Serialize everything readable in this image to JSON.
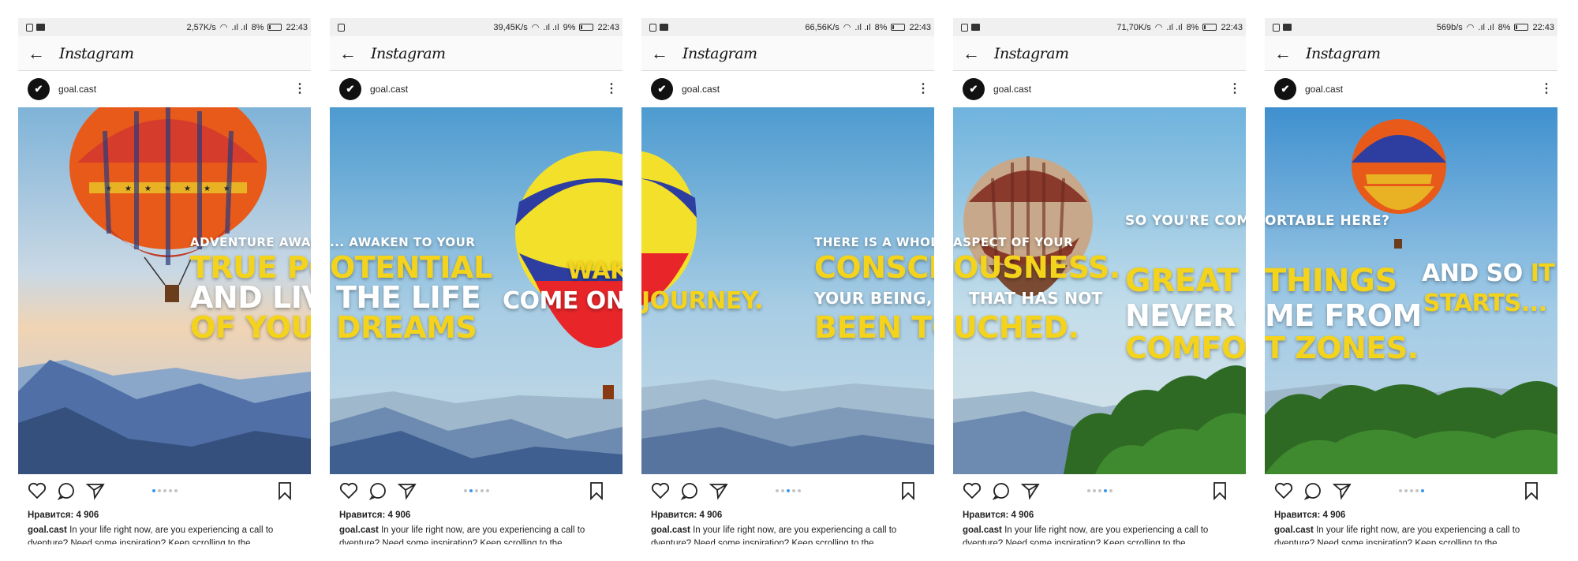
{
  "app": {
    "title": "Instagram",
    "username": "goal.cast",
    "likes": "Нравится: 4 906",
    "caption_text": "In your life right now, are you experiencing a call to",
    "caption_line2": "dventure? Need some inspiration? Keep scrolling to the",
    "back_icon": "arrow-left-icon",
    "accent": "#3897f0",
    "yellow_text_color": "#f4d31c"
  },
  "screens": [
    {
      "status": {
        "speed": "2,57K/s",
        "battery": "8%",
        "time": "22:43"
      },
      "active_dot": 0,
      "overlay": [
        "ADVENTURE AWAITS...",
        "TRUE PO",
        "AND LIVE",
        "OF YOUR"
      ]
    },
    {
      "status": {
        "speed": "39,45K/s",
        "battery": "9%",
        "time": "22:43"
      },
      "active_dot": 1,
      "overlay": [
        "... AWAKEN TO YOUR",
        "OTENTIAL",
        "THE LIFE",
        "DREAMS",
        "WAKE UP.",
        "COME ON A"
      ]
    },
    {
      "status": {
        "speed": "66,56K/s",
        "battery": "8%",
        "time": "22:43"
      },
      "active_dot": 2,
      "overlay": [
        "JOURNEY.",
        "THERE IS A WHOLE",
        "CONSCIO",
        "YOUR BEING, T",
        "BEEN TO"
      ]
    },
    {
      "status": {
        "speed": "71,70K/s",
        "battery": "8%",
        "time": "22:43"
      },
      "active_dot": 3,
      "overlay": [
        "ASPECT OF YOUR",
        "OUSNESS.",
        "THAT HAS NOT",
        "UCHED.",
        "SO YOU'RE COMF",
        "GREAT T",
        "NEVER CA",
        "COMFOR"
      ]
    },
    {
      "status": {
        "speed": "569b/s",
        "battery": "8%",
        "time": "22:43"
      },
      "active_dot": 4,
      "overlay": [
        "ORTABLE HERE?",
        "THINGS",
        "ME FROM",
        "T ZONES.",
        "AND SO",
        "IT",
        "STARTS..."
      ]
    }
  ]
}
